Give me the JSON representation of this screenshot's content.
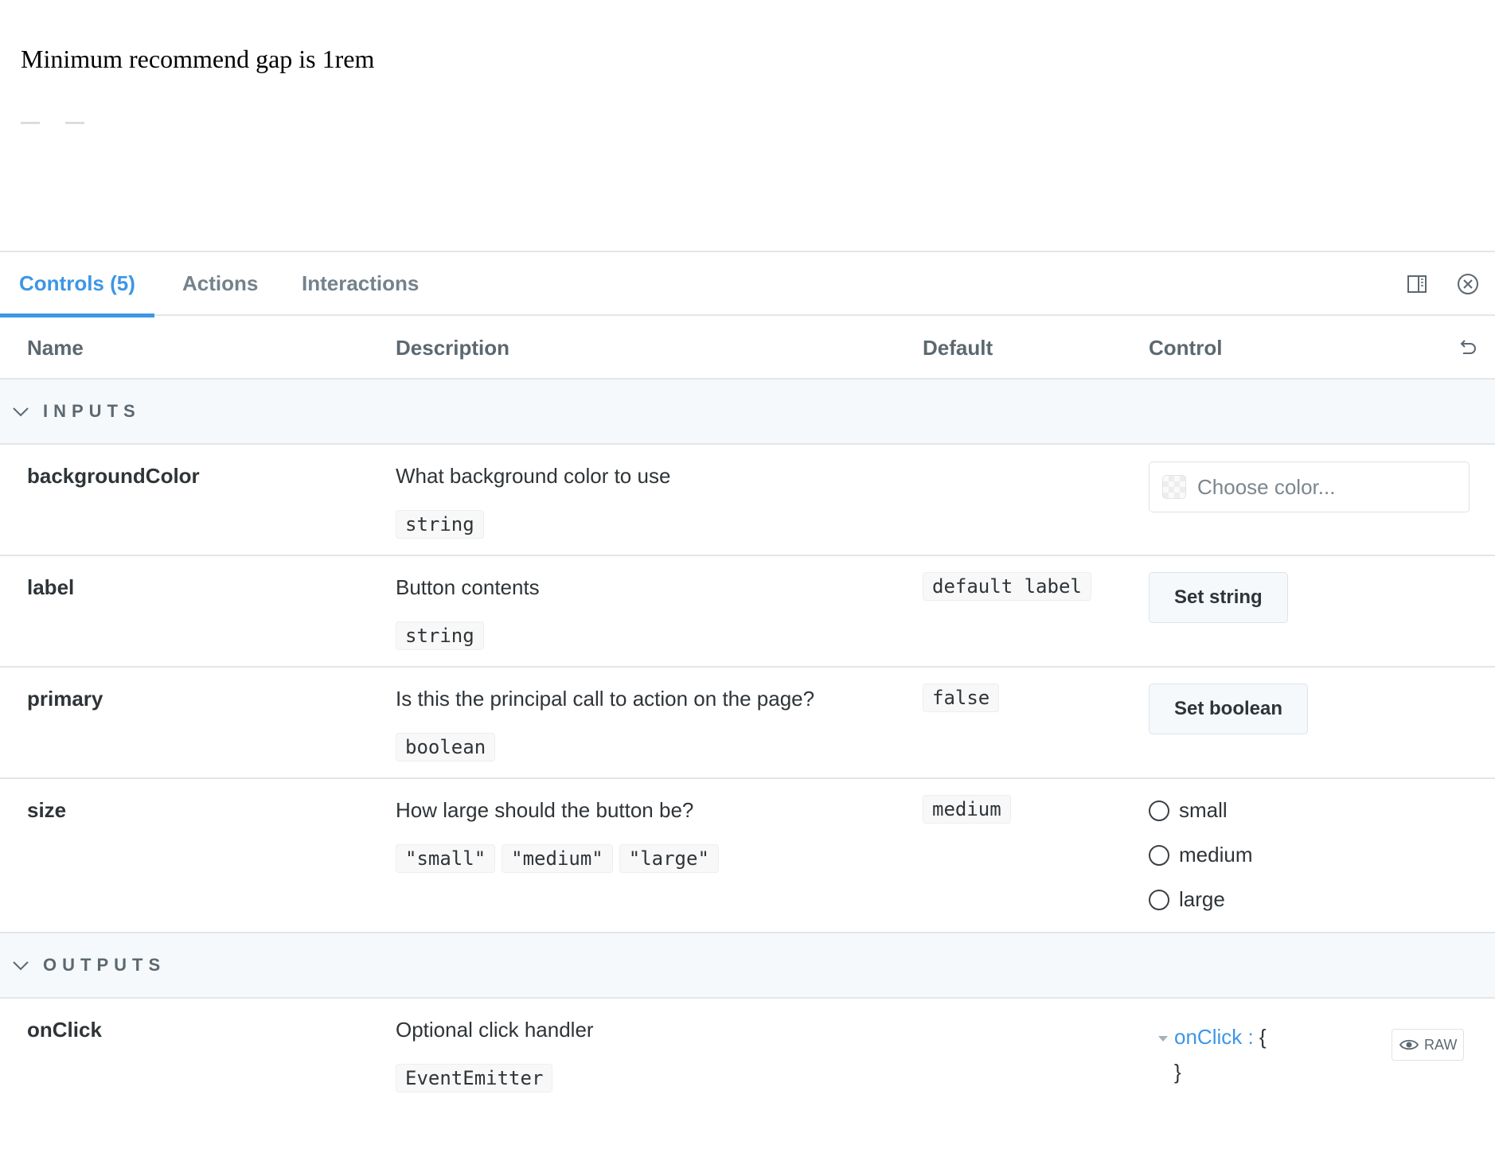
{
  "preview": {
    "title": "Minimum recommend gap is 1rem"
  },
  "tabs": [
    {
      "label": "Controls (5)",
      "active": true
    },
    {
      "label": "Actions",
      "active": false
    },
    {
      "label": "Interactions",
      "active": false
    }
  ],
  "toolbar": {
    "panel_icon": "sidebar-panel-icon",
    "close_icon": "close-circle-icon"
  },
  "table": {
    "headers": {
      "name": "Name",
      "description": "Description",
      "default": "Default",
      "control": "Control"
    },
    "reset_icon": "undo-icon"
  },
  "sections": {
    "inputs": "INPUTS",
    "outputs": "OUTPUTS"
  },
  "rows": {
    "backgroundColor": {
      "name": "backgroundColor",
      "description": "What background color to use",
      "type": "string",
      "control_placeholder": "Choose color..."
    },
    "label": {
      "name": "label",
      "description": "Button contents",
      "type": "string",
      "default": "default label",
      "control_button": "Set string"
    },
    "primary": {
      "name": "primary",
      "description": "Is this the principal call to action on the page?",
      "type": "boolean",
      "default": "false",
      "control_button": "Set boolean"
    },
    "size": {
      "name": "size",
      "description": "How large should the button be?",
      "types": [
        "\"small\"",
        "\"medium\"",
        "\"large\""
      ],
      "default": "medium",
      "options": [
        "small",
        "medium",
        "large"
      ]
    },
    "onClick": {
      "name": "onClick",
      "description": "Optional click handler",
      "type": "EventEmitter",
      "object_key": "onClick",
      "object_sep": " : ",
      "object_open": "{",
      "object_close": "}",
      "raw_label": "RAW"
    }
  },
  "colors": {
    "accent": "#3d96e6",
    "border": "#e3e6e8",
    "section_bg": "#f6f9fc"
  }
}
